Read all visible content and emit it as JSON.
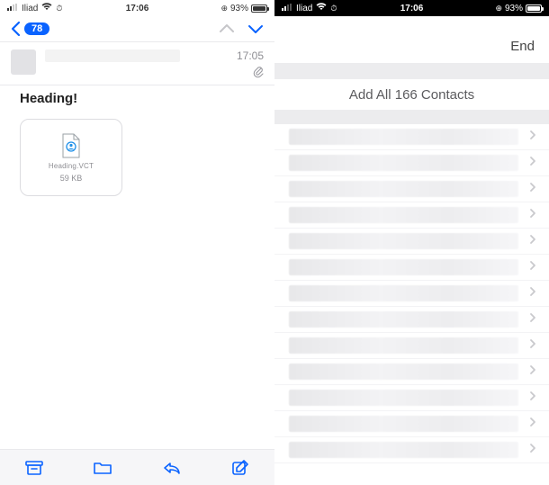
{
  "left": {
    "status": {
      "carrier": "Iliad",
      "time": "17:06",
      "battery_pct": "93%"
    },
    "nav": {
      "count_badge": "78"
    },
    "message": {
      "time": "17:05",
      "heading": "Heading!",
      "attachment": {
        "name": "Heading.VCT",
        "size": "59 KB"
      }
    }
  },
  "right": {
    "status": {
      "carrier": "Iliad",
      "time": "17:06",
      "battery_pct": "93%"
    },
    "end_label": "End",
    "add_all_label": "Add All 166 Contacts",
    "contact_rows": 13
  }
}
